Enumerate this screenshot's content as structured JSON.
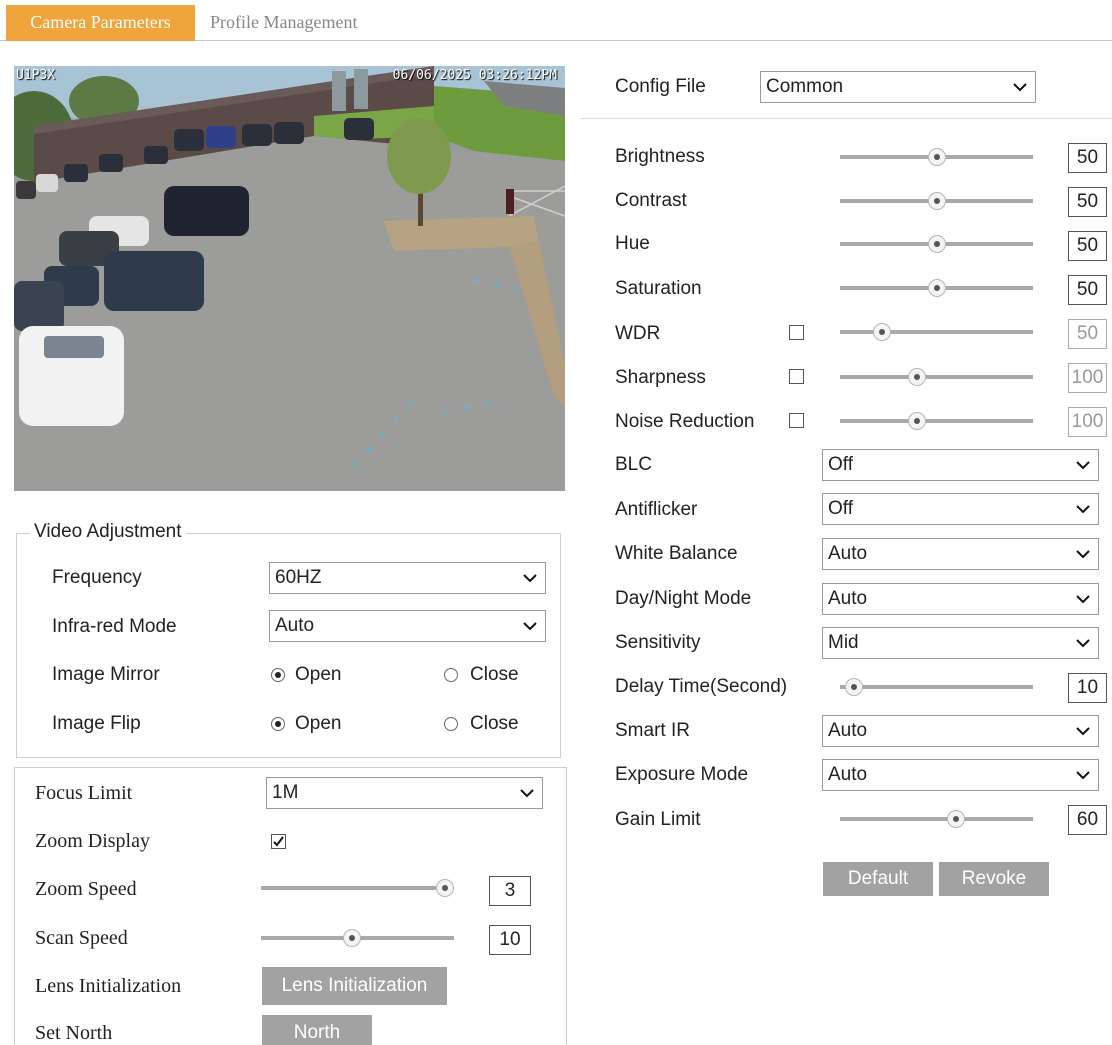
{
  "tabs": {
    "camera_parameters": "Camera Parameters",
    "profile_management": "Profile Management"
  },
  "preview": {
    "osd_left": "U1P3X",
    "osd_timestamp": "06/06/2025 03:26:12PM"
  },
  "video_adjustment": {
    "legend": "Video Adjustment",
    "frequency": {
      "label": "Frequency",
      "value": "60HZ"
    },
    "infrared_mode": {
      "label": "Infra-red Mode",
      "value": "Auto"
    },
    "image_mirror": {
      "label": "Image Mirror",
      "open_label": "Open",
      "close_label": "Close",
      "selected": "Open"
    },
    "image_flip": {
      "label": "Image Flip",
      "open_label": "Open",
      "close_label": "Close",
      "selected": "Open"
    }
  },
  "lens": {
    "focus_limit": {
      "label": "Focus Limit",
      "value": "1M"
    },
    "zoom_display": {
      "label": "Zoom Display",
      "checked": true
    },
    "zoom_speed": {
      "label": "Zoom Speed",
      "value": "3",
      "level": 1.0
    },
    "scan_speed": {
      "label": "Scan Speed",
      "value": "10",
      "level": 0.47
    },
    "lens_initialization": {
      "label": "Lens Initialization",
      "button": "Lens Initialization"
    },
    "set_north": {
      "label": "Set North",
      "button": "North"
    }
  },
  "config": {
    "config_file": {
      "label": "Config File",
      "value": "Common"
    },
    "brightness": {
      "label": "Brightness",
      "value": "50",
      "level": 0.5
    },
    "contrast": {
      "label": "Contrast",
      "value": "50",
      "level": 0.5
    },
    "hue": {
      "label": "Hue",
      "value": "50",
      "level": 0.5
    },
    "saturation": {
      "label": "Saturation",
      "value": "50",
      "level": 0.5
    },
    "wdr": {
      "label": "WDR",
      "value": "50",
      "level": 0.22,
      "checked": false
    },
    "sharpness": {
      "label": "Sharpness",
      "value": "100",
      "level": 0.4,
      "checked": false
    },
    "noise_reduction": {
      "label": "Noise Reduction",
      "value": "100",
      "level": 0.4,
      "checked": false
    },
    "blc": {
      "label": "BLC",
      "value": "Off"
    },
    "antiflicker": {
      "label": "Antiflicker",
      "value": "Off"
    },
    "white_balance": {
      "label": "White Balance",
      "value": "Auto"
    },
    "day_night_mode": {
      "label": "Day/Night Mode",
      "value": "Auto"
    },
    "sensitivity": {
      "label": "Sensitivity",
      "value": "Mid"
    },
    "delay_time": {
      "label": "Delay Time(Second)",
      "value": "10",
      "level": 0.07
    },
    "smart_ir": {
      "label": "Smart IR",
      "value": "Auto"
    },
    "exposure_mode": {
      "label": "Exposure Mode",
      "value": "Auto"
    },
    "gain_limit": {
      "label": "Gain Limit",
      "value": "60",
      "level": 0.6
    },
    "default_button": "Default",
    "revoke_button": "Revoke"
  }
}
